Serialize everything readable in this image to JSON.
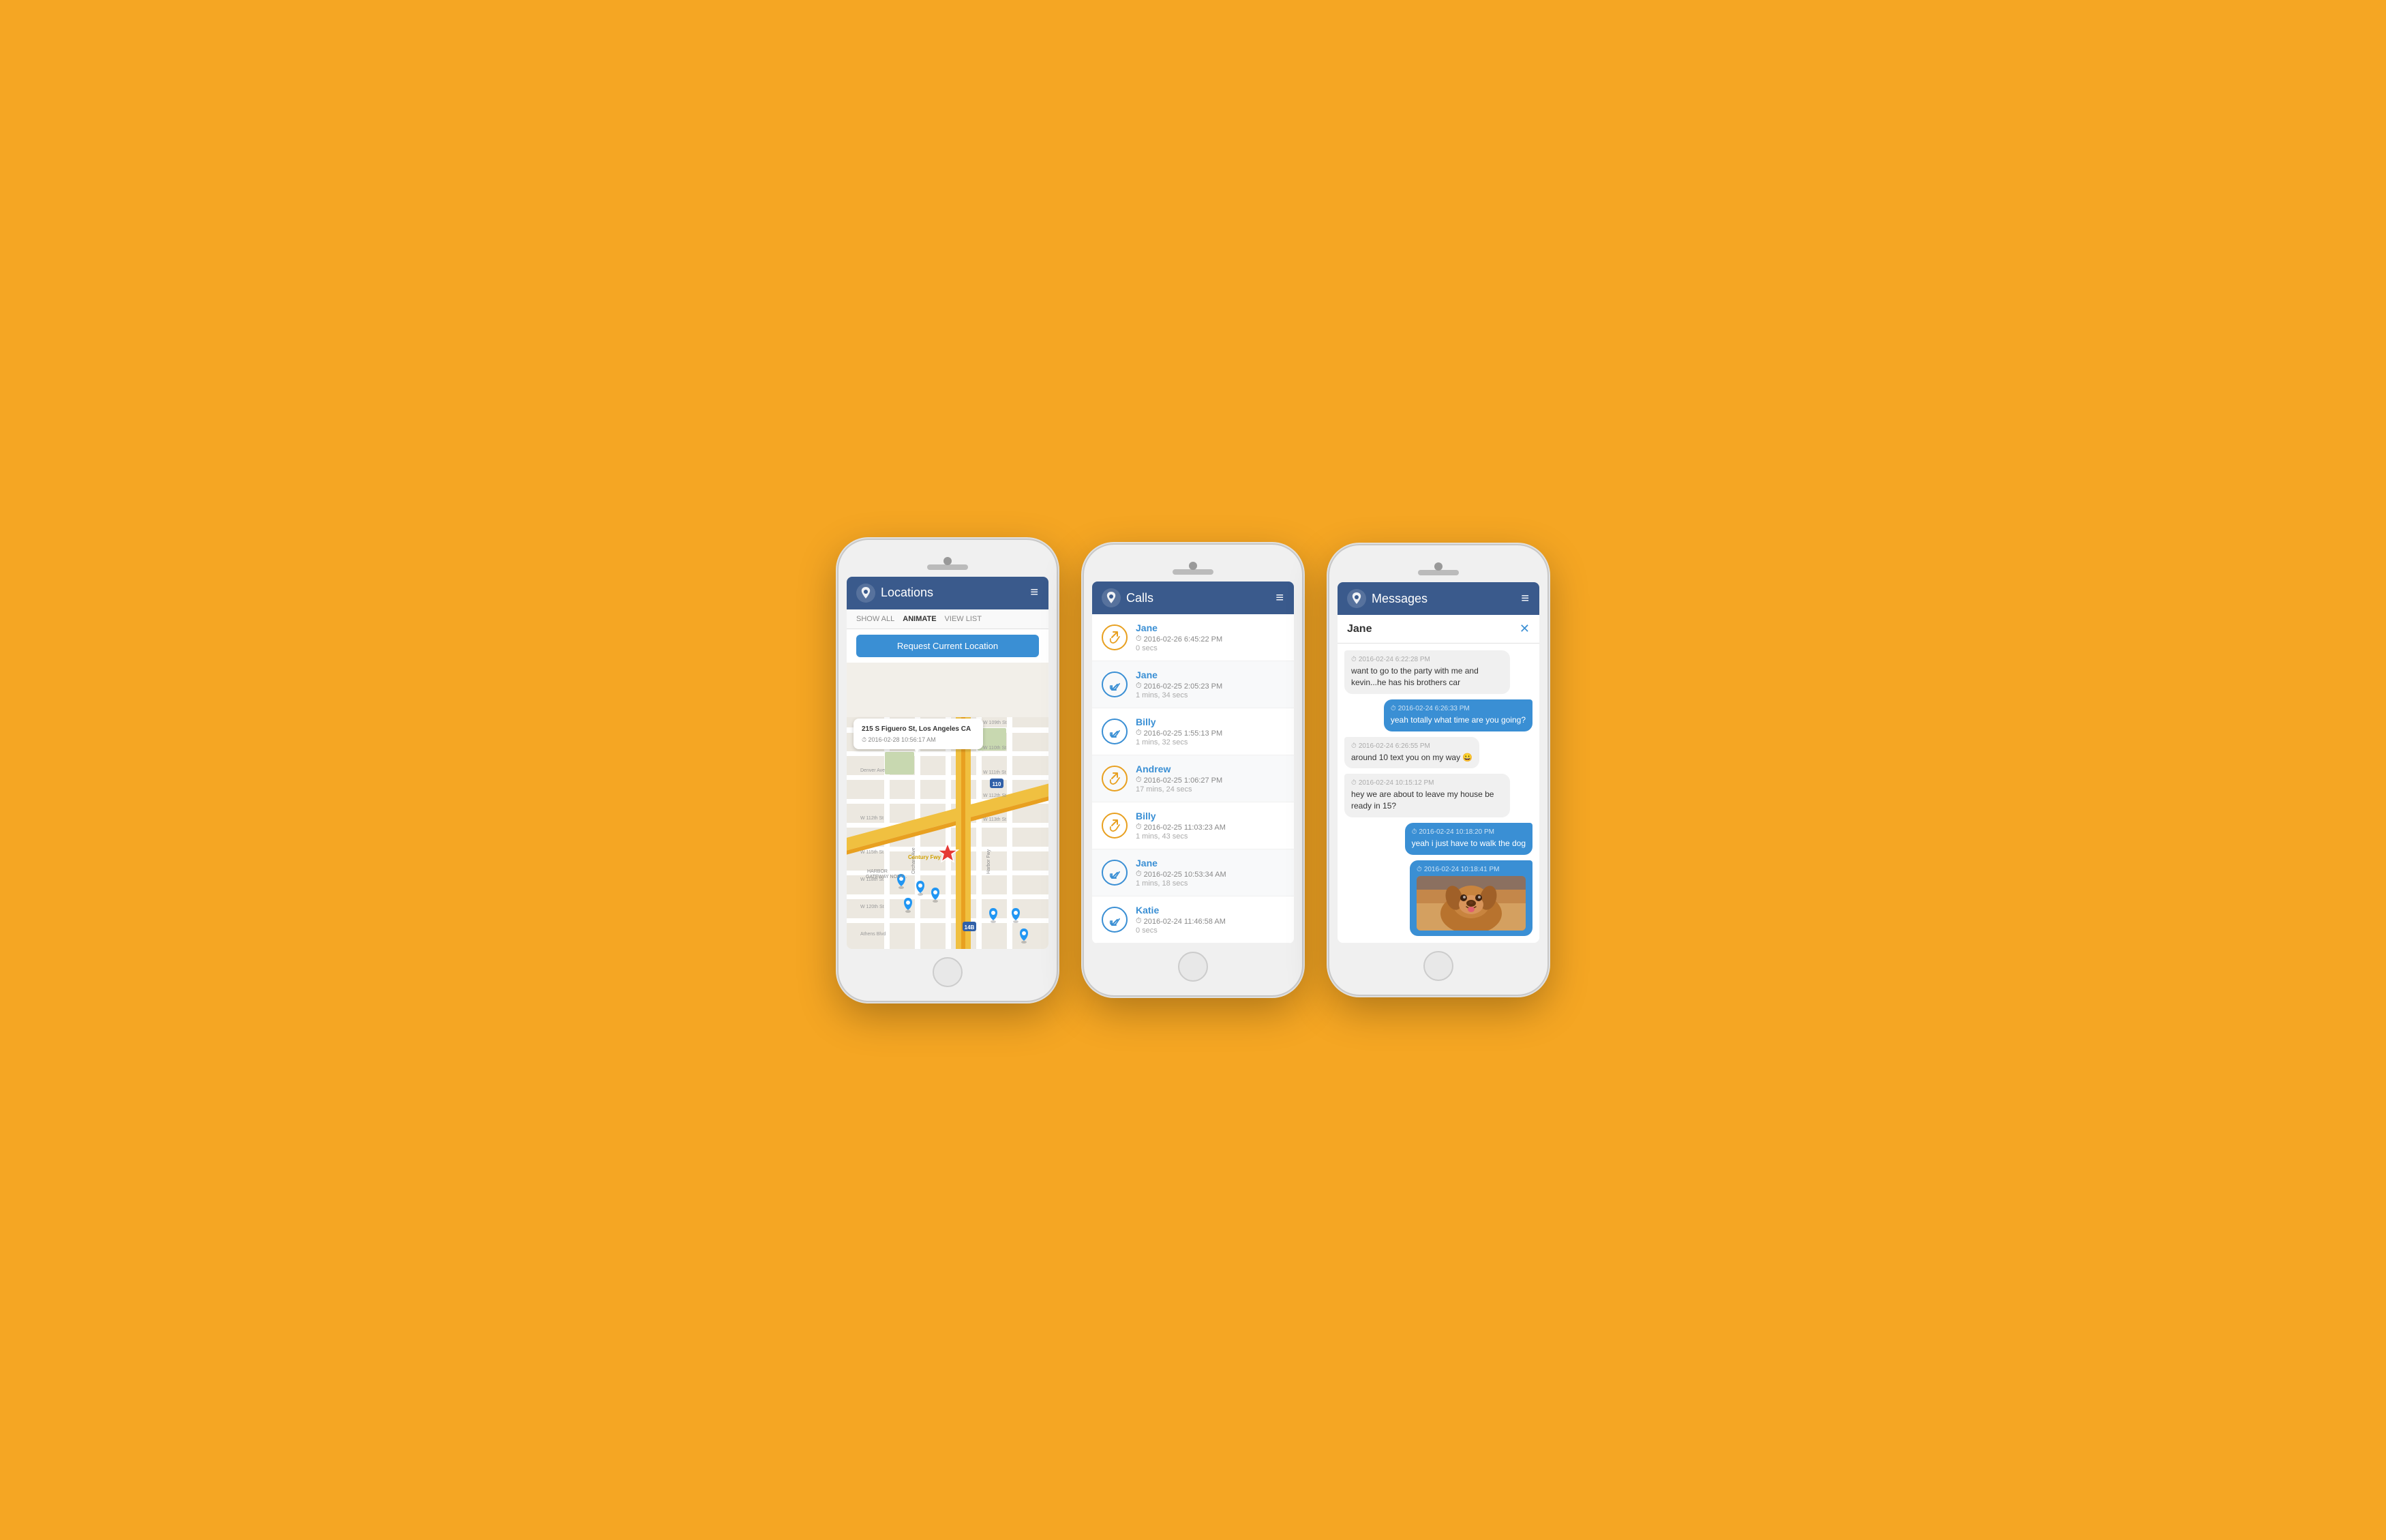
{
  "phones": {
    "locations": {
      "header": {
        "title": "Locations",
        "menu_label": "≡"
      },
      "toolbar": {
        "show_all": "SHOW ALL",
        "animate": "ANIMATE",
        "view_list": "VIEW LIST"
      },
      "request_btn": "Request Current Location",
      "popup": {
        "address": "215 S Figuero St, Los Angeles CA",
        "time": "2016-02-28 10:56:17 AM"
      }
    },
    "calls": {
      "header": {
        "title": "Calls",
        "menu_label": "≡"
      },
      "items": [
        {
          "name": "Jane",
          "datetime": "2016-02-26 6:45:22 PM",
          "duration": "0 secs",
          "type": "outgoing"
        },
        {
          "name": "Jane",
          "datetime": "2016-02-25 2:05:23 PM",
          "duration": "1 mins, 34 secs",
          "type": "incoming"
        },
        {
          "name": "Billy",
          "datetime": "2016-02-25 1:55:13 PM",
          "duration": "1 mins, 32 secs",
          "type": "incoming"
        },
        {
          "name": "Andrew",
          "datetime": "2016-02-25 1:06:27 PM",
          "duration": "17 mins, 24 secs",
          "type": "outgoing"
        },
        {
          "name": "Billy",
          "datetime": "2016-02-25 11:03:23 AM",
          "duration": "1 mins, 43 secs",
          "type": "outgoing"
        },
        {
          "name": "Jane",
          "datetime": "2016-02-25 10:53:34 AM",
          "duration": "1 mins, 18 secs",
          "type": "incoming"
        },
        {
          "name": "Katie",
          "datetime": "2016-02-24 11:46:58 AM",
          "duration": "0 secs",
          "type": "incoming"
        }
      ]
    },
    "messages": {
      "header": {
        "title": "Messages",
        "menu_label": "≡"
      },
      "contact": "Jane",
      "close_label": "✕",
      "items": [
        {
          "side": "left",
          "time": "2016-02-24 6:22:28 PM",
          "text": "want to go to the party with me and kevin...he has his brothers car"
        },
        {
          "side": "right",
          "time": "2016-02-24 6:26:33 PM",
          "text": "yeah totally what time are you going?"
        },
        {
          "side": "left",
          "time": "2016-02-24 6:26:55 PM",
          "text": "around 10 text you on my way 😀"
        },
        {
          "side": "left",
          "time": "2016-02-24 10:15:12 PM",
          "text": "hey we are about to leave my house be ready in 15?"
        },
        {
          "side": "right",
          "time": "2016-02-24 10:18:20 PM",
          "text": "yeah i just have to walk the dog"
        },
        {
          "side": "right",
          "time": "2016-02-24 10:18:41 PM",
          "text": "",
          "has_image": true
        }
      ]
    }
  }
}
